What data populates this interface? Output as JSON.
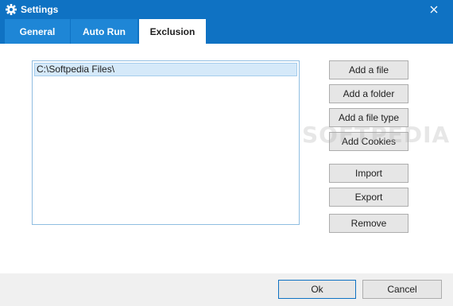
{
  "window": {
    "title": "Settings",
    "icons": {
      "app": "gear-icon",
      "close": "close-icon"
    }
  },
  "tabs": [
    {
      "label": "General",
      "active": false
    },
    {
      "label": "Auto Run",
      "active": false
    },
    {
      "label": "Exclusion",
      "active": true
    }
  ],
  "exclusion": {
    "items": [
      "C:\\Softpedia Files\\"
    ],
    "buttons": {
      "add_file": "Add a file",
      "add_folder": "Add a folder",
      "add_file_type": "Add a file type",
      "add_cookies": "Add Cookies",
      "import": "Import",
      "export": "Export",
      "remove": "Remove"
    }
  },
  "footer": {
    "ok": "Ok",
    "cancel": "Cancel"
  },
  "watermark": "SOFTPEDIA",
  "colors": {
    "titlebar": "#0f72c3",
    "tab_inactive": "#1e86d6",
    "selection": "#d5e9f9",
    "list_border": "#8fbde1"
  }
}
